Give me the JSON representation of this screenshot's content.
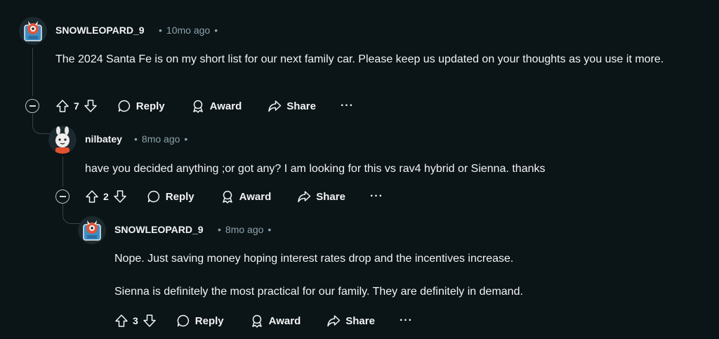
{
  "comments": [
    {
      "author": "SNOWLEOPARD_9",
      "time": "10mo ago",
      "paragraphs": [
        "The 2024 Santa Fe is on my short list for our next family car. Please keep us updated on your thoughts as you use it more."
      ],
      "votes": "7"
    },
    {
      "author": "nilbatey",
      "time": "8mo ago",
      "paragraphs": [
        "have you decided anything ;or got any? I am looking for this vs rav4 hybrid or Sienna. thanks"
      ],
      "votes": "2"
    },
    {
      "author": "SNOWLEOPARD_9",
      "time": "8mo ago",
      "paragraphs": [
        "Nope. Just saving money hoping interest rates drop and the incentives increase.",
        "Sienna is definitely the most practical for our family. They are definitely in demand."
      ],
      "votes": "3"
    }
  ],
  "labels": {
    "reply": "Reply",
    "award": "Award",
    "share": "Share",
    "more": "···",
    "dot": "•"
  },
  "icons": {
    "upvote": "arrow-up-outline-icon",
    "downvote": "arrow-down-outline-icon",
    "reply": "speech-bubble-icon",
    "award": "award-ribbon-icon",
    "share": "share-arrow-icon",
    "more": "ellipsis-icon",
    "collapse": "minus-circle-icon"
  },
  "colors": {
    "background": "#0b1416",
    "text": "#f2f4f5",
    "meta": "#8ba2ad",
    "thread_line": "#33464c"
  }
}
